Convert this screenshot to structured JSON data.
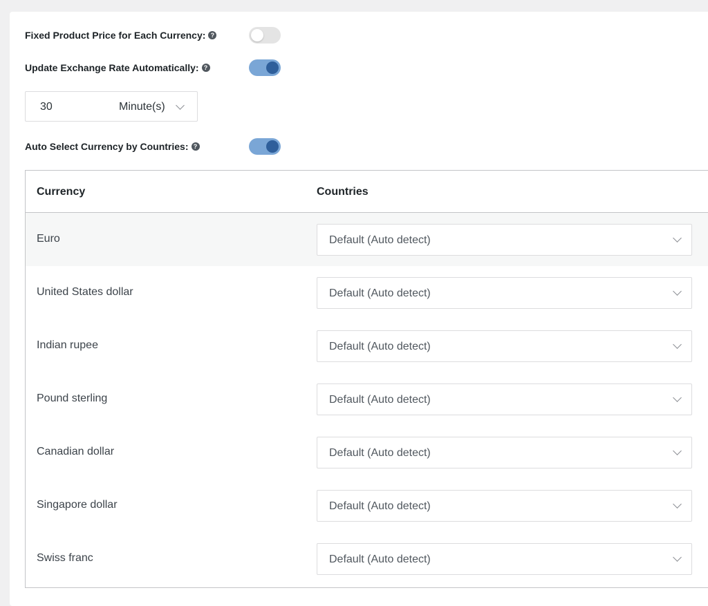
{
  "settings": {
    "fixed_price": {
      "label": "Fixed Product Price for Each Currency:",
      "enabled": false
    },
    "update_rate": {
      "label": "Update Exchange Rate Automatically:",
      "enabled": true
    },
    "interval": {
      "value": "30",
      "unit": "Minute(s)"
    },
    "auto_select": {
      "label": "Auto Select Currency by Countries:",
      "enabled": true
    }
  },
  "help_icon": "?",
  "table": {
    "headers": {
      "currency": "Currency",
      "countries": "Countries"
    },
    "rows": [
      {
        "currency": "Euro",
        "countries": "Default (Auto detect)"
      },
      {
        "currency": "United States dollar",
        "countries": "Default (Auto detect)"
      },
      {
        "currency": "Indian rupee",
        "countries": "Default (Auto detect)"
      },
      {
        "currency": "Pound sterling",
        "countries": "Default (Auto detect)"
      },
      {
        "currency": "Canadian dollar",
        "countries": "Default (Auto detect)"
      },
      {
        "currency": "Singapore dollar",
        "countries": "Default (Auto detect)"
      },
      {
        "currency": "Swiss franc",
        "countries": "Default (Auto detect)"
      }
    ]
  },
  "colors": {
    "toggle_on_track": "#7aa6d6",
    "toggle_on_knob": "#2f5f9b",
    "toggle_off_track": "#e4e4e4"
  }
}
